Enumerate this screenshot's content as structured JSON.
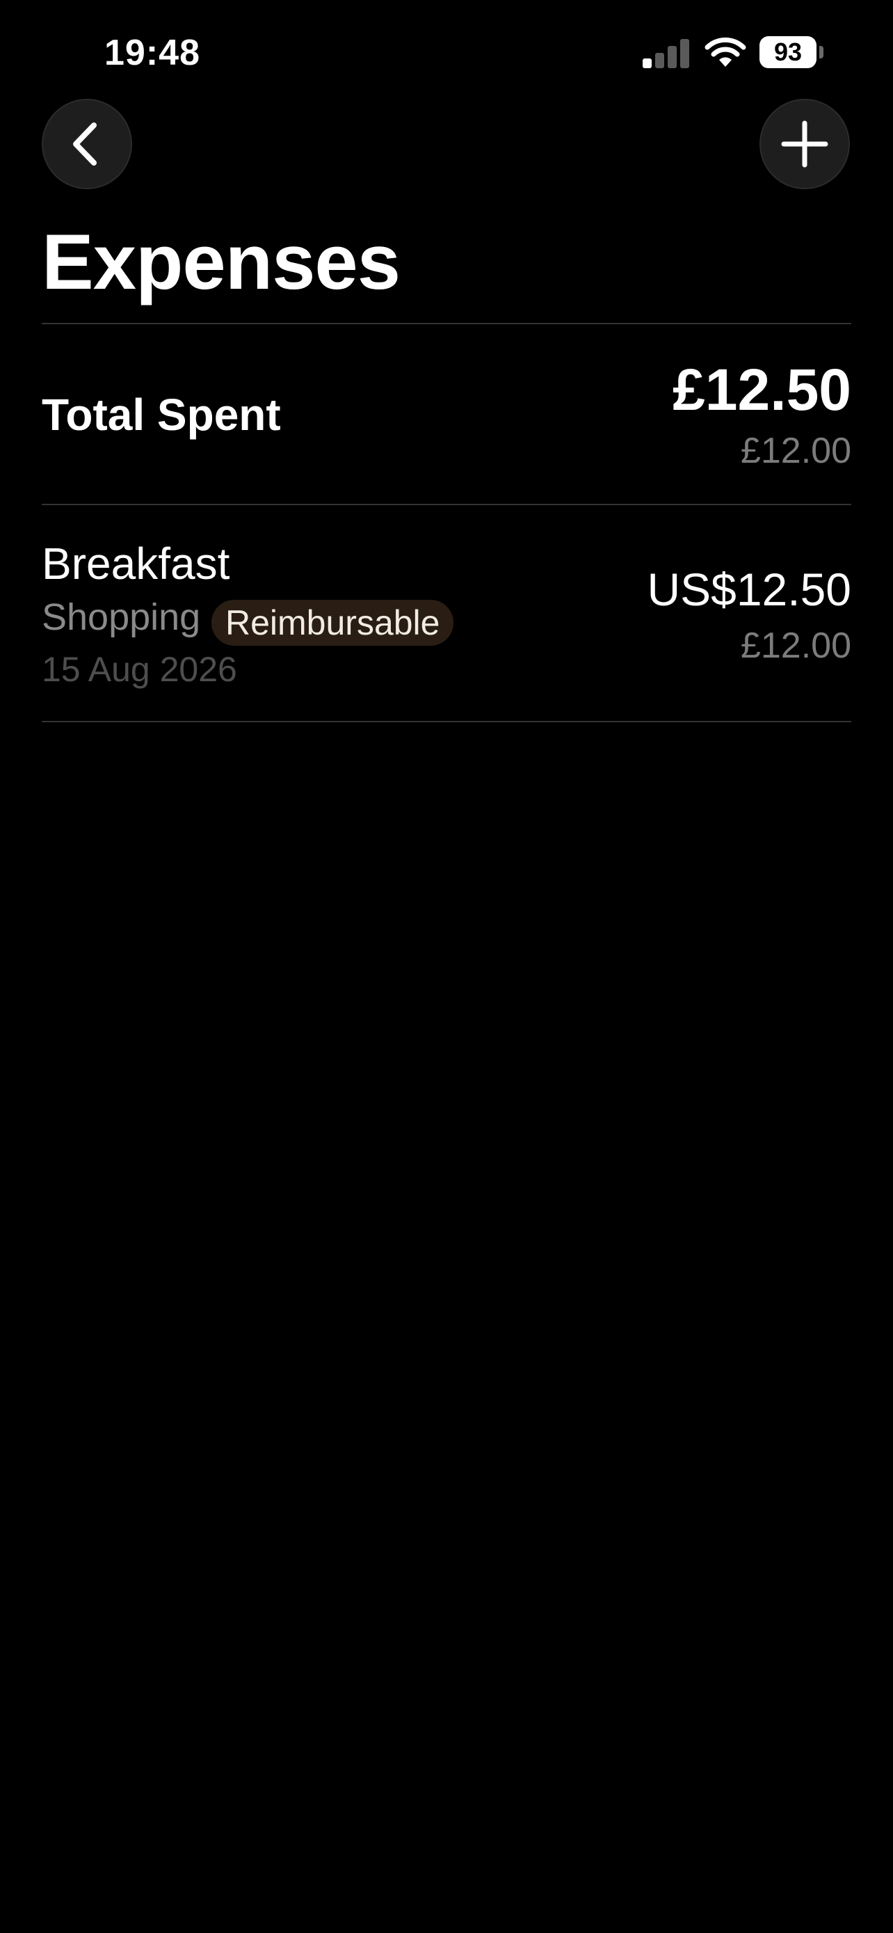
{
  "status_bar": {
    "time": "19:48",
    "battery_level": "93",
    "signal_bars_active": 1,
    "signal_bars_total": 4,
    "icons": [
      "cellular-signal-icon",
      "wifi-icon",
      "battery-icon"
    ]
  },
  "nav": {
    "back_icon": "chevron-left-icon",
    "add_icon": "plus-icon"
  },
  "page": {
    "title": "Expenses"
  },
  "summary": {
    "label": "Total Spent",
    "amount": "£12.50",
    "secondary_amount": "£12.00"
  },
  "expenses": [
    {
      "title": "Breakfast",
      "category": "Shopping",
      "badge": "Reimbursable",
      "date": "15 Aug 2026",
      "amount": "US$12.50",
      "secondary_amount": "£12.00"
    }
  ],
  "colors": {
    "background": "#000000",
    "primary_text": "#ffffff",
    "secondary_text": "#7c7c7c",
    "badge_background": "#2a1e14",
    "divider": "#333333"
  }
}
